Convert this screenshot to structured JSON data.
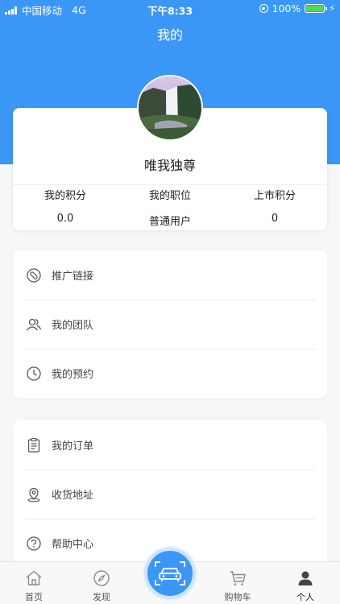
{
  "status_bar": {
    "carrier": "中国移动",
    "network": "4G",
    "time": "下午8:33",
    "battery": "100%"
  },
  "header": {
    "title": "我的"
  },
  "profile": {
    "username": "唯我独尊",
    "stats": [
      {
        "label": "我的积分",
        "value": "0.0"
      },
      {
        "label": "我的职位",
        "value": "普通用户"
      },
      {
        "label": "上市积分",
        "value": "0"
      }
    ]
  },
  "menu_group_1": {
    "items": [
      {
        "label": "推广链接",
        "icon": "link-icon"
      },
      {
        "label": "我的团队",
        "icon": "team-icon"
      },
      {
        "label": "我的预约",
        "icon": "clock-icon"
      }
    ]
  },
  "menu_group_2": {
    "items": [
      {
        "label": "我的订单",
        "icon": "clipboard-icon"
      },
      {
        "label": "收货地址",
        "icon": "location-icon"
      },
      {
        "label": "帮助中心",
        "icon": "help-icon"
      }
    ]
  },
  "tab_bar": {
    "tabs": [
      {
        "label": "首页",
        "icon": "home-icon"
      },
      {
        "label": "发现",
        "icon": "compass-icon"
      },
      {
        "label": "购物车",
        "icon": "cart-icon"
      },
      {
        "label": "个人",
        "icon": "person-icon"
      }
    ],
    "center_icon": "car-scan-icon",
    "active_tab": "个人"
  },
  "colors": {
    "primary": "#3a97f6",
    "background": "#f6f7f9"
  }
}
